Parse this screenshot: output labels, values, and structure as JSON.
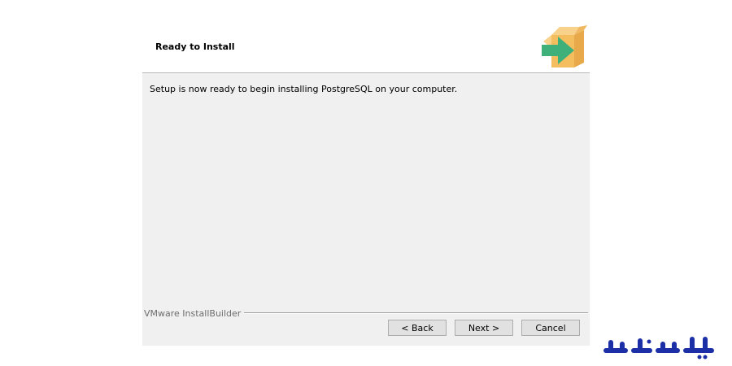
{
  "header": {
    "title": "Ready to Install",
    "icon": "install-box-arrow-icon"
  },
  "body": {
    "message": "Setup is now ready to begin installing PostgreSQL on your computer."
  },
  "footer": {
    "builder_label": "VMware InstallBuilder"
  },
  "buttons": {
    "back": "< Back",
    "next": "Next >",
    "cancel": "Cancel"
  },
  "watermark": {
    "text": "ایران سرور",
    "color": "#1d2fa6"
  },
  "colors": {
    "box": "#f5c46a",
    "arrow": "#3fb07a"
  }
}
